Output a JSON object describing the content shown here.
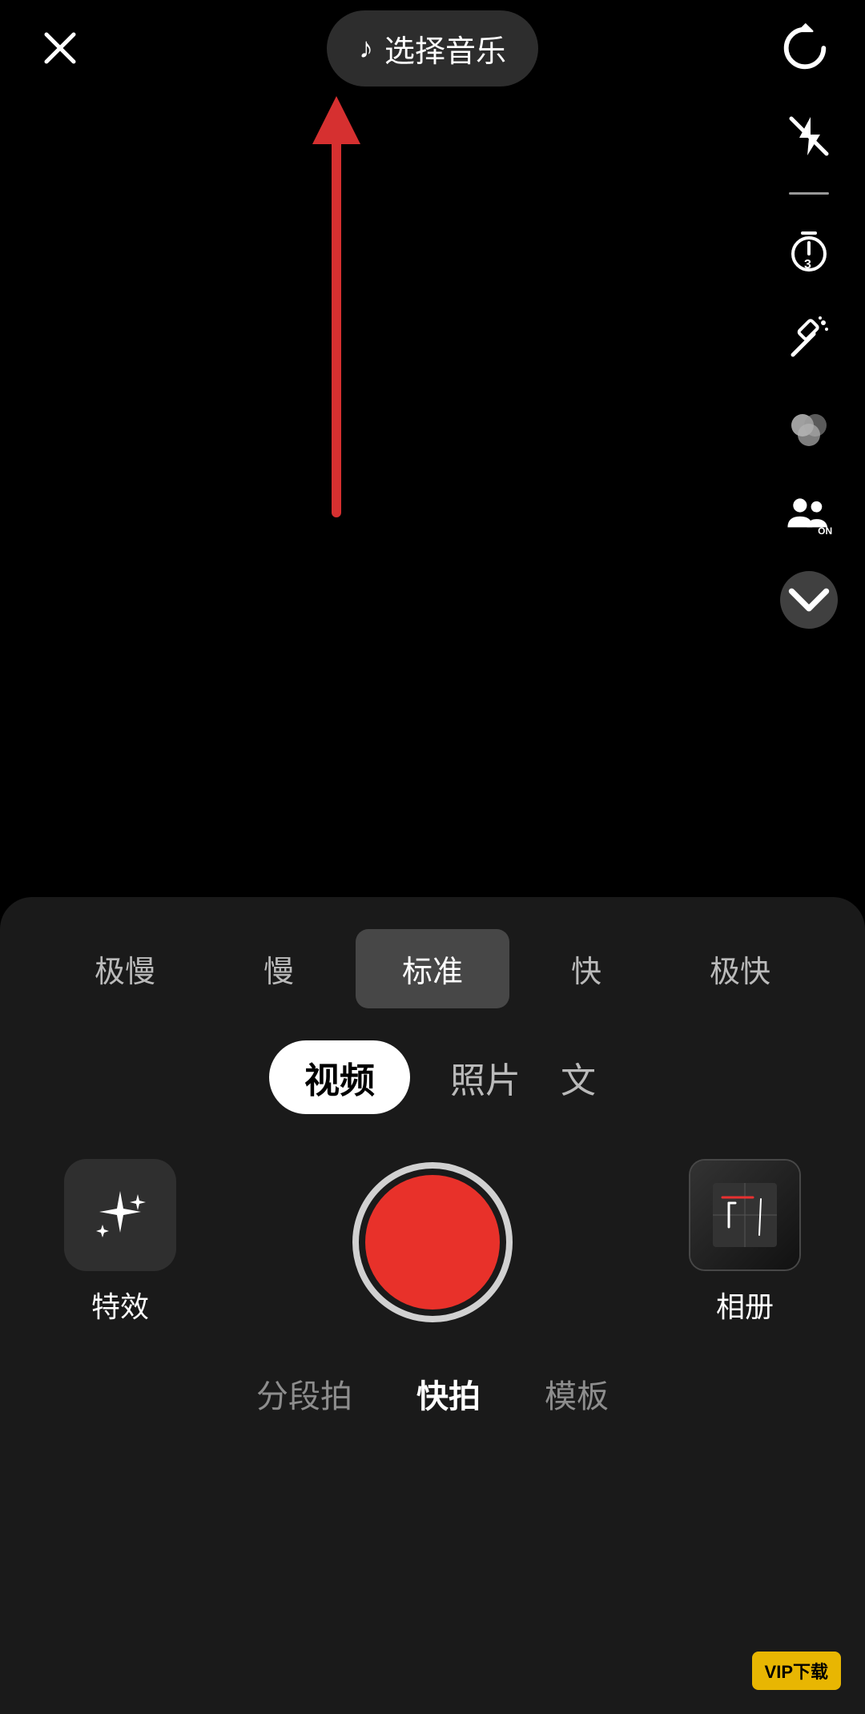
{
  "header": {
    "close_label": "×",
    "music_button_label": "选择音乐",
    "refresh_icon": "refresh-icon"
  },
  "sidebar": {
    "icons": [
      {
        "name": "flash-off-icon",
        "label": "闪光灯关"
      },
      {
        "name": "timer-icon",
        "label": "倒计时"
      },
      {
        "name": "beautify-icon",
        "label": "美化"
      },
      {
        "name": "filter-icon",
        "label": "滤镜"
      },
      {
        "name": "ar-icon",
        "label": "AR"
      },
      {
        "name": "more-icon",
        "label": "更多"
      }
    ]
  },
  "speed_options": [
    {
      "label": "极慢",
      "active": false
    },
    {
      "label": "慢",
      "active": false
    },
    {
      "label": "标准",
      "active": true
    },
    {
      "label": "快",
      "active": false
    },
    {
      "label": "极快",
      "active": false
    }
  ],
  "modes": [
    {
      "label": "视频",
      "active": true
    },
    {
      "label": "照片",
      "active": false
    },
    {
      "label": "文",
      "active": false
    }
  ],
  "controls": {
    "effects_label": "特效",
    "album_label": "相册"
  },
  "bottom_tabs": [
    {
      "label": "分段拍",
      "active": false
    },
    {
      "label": "快拍",
      "active": true
    },
    {
      "label": "模板",
      "active": false
    }
  ],
  "watermark": "VIP下载"
}
